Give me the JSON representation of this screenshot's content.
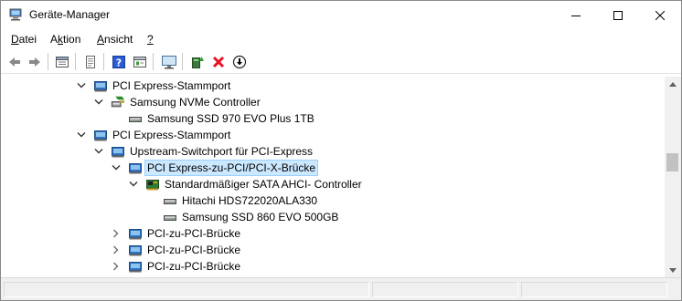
{
  "window": {
    "title": "Geräte-Manager"
  },
  "menu": [
    {
      "label": "Datei"
    },
    {
      "label": "Aktion"
    },
    {
      "label": "Ansicht"
    },
    {
      "label": "?"
    }
  ],
  "toolbar": {
    "icons": [
      "back-icon",
      "forward-icon",
      "properties-icon",
      "show-hidden-icon",
      "help-icon",
      "view-icon",
      "monitor-icon",
      "update-driver-icon",
      "uninstall-icon",
      "download-icon"
    ]
  },
  "tree": {
    "nodes": [
      {
        "label": "PCI Express-Stammport",
        "expanded": true,
        "icon": "pci-bus-icon"
      },
      {
        "label": "Samsung NVMe Controller",
        "expanded": true,
        "icon": "storage-controller-icon"
      },
      {
        "label": "Samsung SSD 970 EVO Plus 1TB",
        "icon": "disk-drive-icon"
      },
      {
        "label": "PCI Express-Stammport",
        "expanded": true,
        "icon": "pci-bus-icon"
      },
      {
        "label": "Upstream-Switchport für PCI-Express",
        "expanded": true,
        "icon": "pci-bus-icon"
      },
      {
        "label": "PCI Express-zu-PCI/PCI-X-Brücke",
        "expanded": true,
        "selected": true,
        "icon": "pci-bus-icon"
      },
      {
        "label": "Standardmäßiger SATA AHCI- Controller",
        "expanded": true,
        "icon": "sata-controller-icon"
      },
      {
        "label": "Hitachi HDS722020ALA330",
        "icon": "disk-drive-icon"
      },
      {
        "label": "Samsung SSD 860 EVO 500GB",
        "icon": "disk-drive-icon"
      },
      {
        "label": "PCI-zu-PCI-Brücke",
        "expanded": false,
        "icon": "pci-bus-icon"
      },
      {
        "label": "PCI-zu-PCI-Brücke",
        "expanded": false,
        "icon": "pci-bus-icon"
      },
      {
        "label": "PCI-zu-PCI-Brücke",
        "expanded": false,
        "icon": "pci-bus-icon"
      }
    ]
  },
  "colors": {
    "selection_bg": "#cce8ff",
    "selection_border": "#99d1ff",
    "uninstall_red": "#e81123",
    "help_blue": "#2a5bd7"
  }
}
